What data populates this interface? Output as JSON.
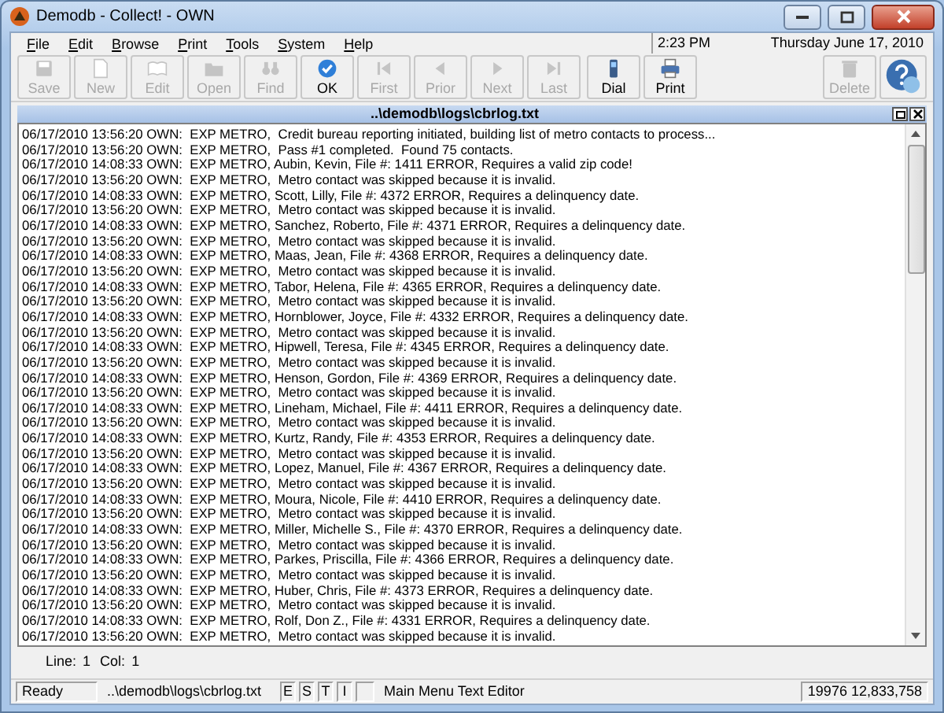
{
  "window": {
    "title": "Demodb - Collect! - OWN"
  },
  "menu": [
    {
      "label": "File"
    },
    {
      "label": "Edit"
    },
    {
      "label": "Browse"
    },
    {
      "label": "Print"
    },
    {
      "label": "Tools"
    },
    {
      "label": "System"
    },
    {
      "label": "Help"
    }
  ],
  "clock": {
    "time": "2:23 PM",
    "date": "Thursday  June 17, 2010"
  },
  "toolbar": [
    {
      "label": "Save",
      "disabled": true
    },
    {
      "label": "New",
      "disabled": true
    },
    {
      "label": "Edit",
      "disabled": true
    },
    {
      "label": "Open",
      "disabled": true
    },
    {
      "label": "Find",
      "disabled": true
    },
    {
      "label": "OK",
      "disabled": false
    },
    {
      "label": "First",
      "disabled": true
    },
    {
      "label": "Prior",
      "disabled": true
    },
    {
      "label": "Next",
      "disabled": true
    },
    {
      "label": "Last",
      "disabled": true
    },
    {
      "label": "Dial",
      "disabled": false
    },
    {
      "label": "Print",
      "disabled": false
    }
  ],
  "toolbar_right": [
    {
      "label": "Delete",
      "disabled": true
    }
  ],
  "document": {
    "title": "..\\demodb\\logs\\cbrlog.txt",
    "lines": [
      "06/17/2010 13:56:20 OWN:  EXP METRO,  Credit bureau reporting initiated, building list of metro contacts to process...",
      "06/17/2010 13:56:20 OWN:  EXP METRO,  Pass #1 completed.  Found 75 contacts.",
      "06/17/2010 14:08:33 OWN:  EXP METRO, Aubin, Kevin, File #: 1411 ERROR, Requires a valid zip code!",
      "06/17/2010 13:56:20 OWN:  EXP METRO,  Metro contact was skipped because it is invalid.",
      "06/17/2010 14:08:33 OWN:  EXP METRO, Scott, Lilly, File #: 4372 ERROR, Requires a delinquency date.",
      "06/17/2010 13:56:20 OWN:  EXP METRO,  Metro contact was skipped because it is invalid.",
      "06/17/2010 14:08:33 OWN:  EXP METRO, Sanchez, Roberto, File #: 4371 ERROR, Requires a delinquency date.",
      "06/17/2010 13:56:20 OWN:  EXP METRO,  Metro contact was skipped because it is invalid.",
      "06/17/2010 14:08:33 OWN:  EXP METRO, Maas, Jean, File #: 4368 ERROR, Requires a delinquency date.",
      "06/17/2010 13:56:20 OWN:  EXP METRO,  Metro contact was skipped because it is invalid.",
      "06/17/2010 14:08:33 OWN:  EXP METRO, Tabor, Helena, File #: 4365 ERROR, Requires a delinquency date.",
      "06/17/2010 13:56:20 OWN:  EXP METRO,  Metro contact was skipped because it is invalid.",
      "06/17/2010 14:08:33 OWN:  EXP METRO, Hornblower, Joyce, File #: 4332 ERROR, Requires a delinquency date.",
      "06/17/2010 13:56:20 OWN:  EXP METRO,  Metro contact was skipped because it is invalid.",
      "06/17/2010 14:08:33 OWN:  EXP METRO, Hipwell, Teresa, File #: 4345 ERROR, Requires a delinquency date.",
      "06/17/2010 13:56:20 OWN:  EXP METRO,  Metro contact was skipped because it is invalid.",
      "06/17/2010 14:08:33 OWN:  EXP METRO, Henson, Gordon, File #: 4369 ERROR, Requires a delinquency date.",
      "06/17/2010 13:56:20 OWN:  EXP METRO,  Metro contact was skipped because it is invalid.",
      "06/17/2010 14:08:33 OWN:  EXP METRO, Lineham, Michael, File #: 4411 ERROR, Requires a delinquency date.",
      "06/17/2010 13:56:20 OWN:  EXP METRO,  Metro contact was skipped because it is invalid.",
      "06/17/2010 14:08:33 OWN:  EXP METRO, Kurtz, Randy, File #: 4353 ERROR, Requires a delinquency date.",
      "06/17/2010 13:56:20 OWN:  EXP METRO,  Metro contact was skipped because it is invalid.",
      "06/17/2010 14:08:33 OWN:  EXP METRO, Lopez, Manuel, File #: 4367 ERROR, Requires a delinquency date.",
      "06/17/2010 13:56:20 OWN:  EXP METRO,  Metro contact was skipped because it is invalid.",
      "06/17/2010 14:08:33 OWN:  EXP METRO, Moura, Nicole, File #: 4410 ERROR, Requires a delinquency date.",
      "06/17/2010 13:56:20 OWN:  EXP METRO,  Metro contact was skipped because it is invalid.",
      "06/17/2010 14:08:33 OWN:  EXP METRO, Miller, Michelle S., File #: 4370 ERROR, Requires a delinquency date.",
      "06/17/2010 13:56:20 OWN:  EXP METRO,  Metro contact was skipped because it is invalid.",
      "06/17/2010 14:08:33 OWN:  EXP METRO, Parkes, Priscilla, File #: 4366 ERROR, Requires a delinquency date.",
      "06/17/2010 13:56:20 OWN:  EXP METRO,  Metro contact was skipped because it is invalid.",
      "06/17/2010 14:08:33 OWN:  EXP METRO, Huber, Chris, File #: 4373 ERROR, Requires a delinquency date.",
      "06/17/2010 13:56:20 OWN:  EXP METRO,  Metro contact was skipped because it is invalid.",
      "06/17/2010 14:08:33 OWN:  EXP METRO, Rolf, Don Z., File #: 4331 ERROR, Requires a delinquency date.",
      "06/17/2010 13:56:20 OWN:  EXP METRO,  Metro contact was skipped because it is invalid."
    ],
    "cursor": {
      "line_label": "Line:",
      "line": "1",
      "col_label": "Col:",
      "col": "1"
    }
  },
  "status_bar": {
    "state": "Ready",
    "path": "..\\demodb\\logs\\cbrlog.txt",
    "flags": [
      "E",
      "S",
      "T",
      "I"
    ],
    "mode": "Main Menu Text Editor",
    "counts": "19976 12,833,758"
  }
}
